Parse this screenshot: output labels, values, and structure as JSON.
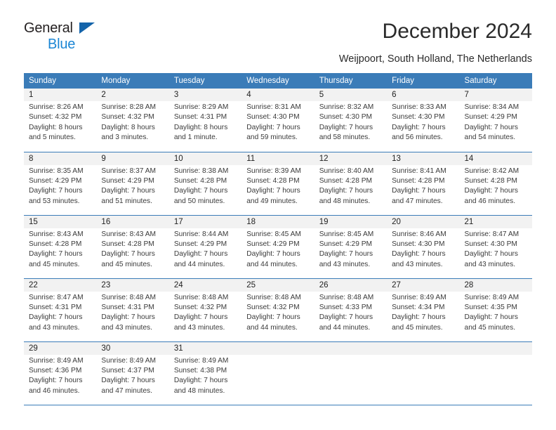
{
  "brand": {
    "name_top": "General",
    "name_bottom": "Blue",
    "accent_color": "#1b86d4",
    "triangle_color": "#1464aa"
  },
  "header": {
    "title": "December 2024",
    "subtitle": "Weijpoort, South Holland, The Netherlands"
  },
  "calendar": {
    "header_bg": "#3b7cb8",
    "weekdays": [
      "Sunday",
      "Monday",
      "Tuesday",
      "Wednesday",
      "Thursday",
      "Friday",
      "Saturday"
    ],
    "weeks": [
      [
        {
          "day": "1",
          "sunrise": "Sunrise: 8:26 AM",
          "sunset": "Sunset: 4:32 PM",
          "daylight1": "Daylight: 8 hours",
          "daylight2": "and 5 minutes."
        },
        {
          "day": "2",
          "sunrise": "Sunrise: 8:28 AM",
          "sunset": "Sunset: 4:32 PM",
          "daylight1": "Daylight: 8 hours",
          "daylight2": "and 3 minutes."
        },
        {
          "day": "3",
          "sunrise": "Sunrise: 8:29 AM",
          "sunset": "Sunset: 4:31 PM",
          "daylight1": "Daylight: 8 hours",
          "daylight2": "and 1 minute."
        },
        {
          "day": "4",
          "sunrise": "Sunrise: 8:31 AM",
          "sunset": "Sunset: 4:30 PM",
          "daylight1": "Daylight: 7 hours",
          "daylight2": "and 59 minutes."
        },
        {
          "day": "5",
          "sunrise": "Sunrise: 8:32 AM",
          "sunset": "Sunset: 4:30 PM",
          "daylight1": "Daylight: 7 hours",
          "daylight2": "and 58 minutes."
        },
        {
          "day": "6",
          "sunrise": "Sunrise: 8:33 AM",
          "sunset": "Sunset: 4:30 PM",
          "daylight1": "Daylight: 7 hours",
          "daylight2": "and 56 minutes."
        },
        {
          "day": "7",
          "sunrise": "Sunrise: 8:34 AM",
          "sunset": "Sunset: 4:29 PM",
          "daylight1": "Daylight: 7 hours",
          "daylight2": "and 54 minutes."
        }
      ],
      [
        {
          "day": "8",
          "sunrise": "Sunrise: 8:35 AM",
          "sunset": "Sunset: 4:29 PM",
          "daylight1": "Daylight: 7 hours",
          "daylight2": "and 53 minutes."
        },
        {
          "day": "9",
          "sunrise": "Sunrise: 8:37 AM",
          "sunset": "Sunset: 4:29 PM",
          "daylight1": "Daylight: 7 hours",
          "daylight2": "and 51 minutes."
        },
        {
          "day": "10",
          "sunrise": "Sunrise: 8:38 AM",
          "sunset": "Sunset: 4:28 PM",
          "daylight1": "Daylight: 7 hours",
          "daylight2": "and 50 minutes."
        },
        {
          "day": "11",
          "sunrise": "Sunrise: 8:39 AM",
          "sunset": "Sunset: 4:28 PM",
          "daylight1": "Daylight: 7 hours",
          "daylight2": "and 49 minutes."
        },
        {
          "day": "12",
          "sunrise": "Sunrise: 8:40 AM",
          "sunset": "Sunset: 4:28 PM",
          "daylight1": "Daylight: 7 hours",
          "daylight2": "and 48 minutes."
        },
        {
          "day": "13",
          "sunrise": "Sunrise: 8:41 AM",
          "sunset": "Sunset: 4:28 PM",
          "daylight1": "Daylight: 7 hours",
          "daylight2": "and 47 minutes."
        },
        {
          "day": "14",
          "sunrise": "Sunrise: 8:42 AM",
          "sunset": "Sunset: 4:28 PM",
          "daylight1": "Daylight: 7 hours",
          "daylight2": "and 46 minutes."
        }
      ],
      [
        {
          "day": "15",
          "sunrise": "Sunrise: 8:43 AM",
          "sunset": "Sunset: 4:28 PM",
          "daylight1": "Daylight: 7 hours",
          "daylight2": "and 45 minutes."
        },
        {
          "day": "16",
          "sunrise": "Sunrise: 8:43 AM",
          "sunset": "Sunset: 4:28 PM",
          "daylight1": "Daylight: 7 hours",
          "daylight2": "and 45 minutes."
        },
        {
          "day": "17",
          "sunrise": "Sunrise: 8:44 AM",
          "sunset": "Sunset: 4:29 PM",
          "daylight1": "Daylight: 7 hours",
          "daylight2": "and 44 minutes."
        },
        {
          "day": "18",
          "sunrise": "Sunrise: 8:45 AM",
          "sunset": "Sunset: 4:29 PM",
          "daylight1": "Daylight: 7 hours",
          "daylight2": "and 44 minutes."
        },
        {
          "day": "19",
          "sunrise": "Sunrise: 8:45 AM",
          "sunset": "Sunset: 4:29 PM",
          "daylight1": "Daylight: 7 hours",
          "daylight2": "and 43 minutes."
        },
        {
          "day": "20",
          "sunrise": "Sunrise: 8:46 AM",
          "sunset": "Sunset: 4:30 PM",
          "daylight1": "Daylight: 7 hours",
          "daylight2": "and 43 minutes."
        },
        {
          "day": "21",
          "sunrise": "Sunrise: 8:47 AM",
          "sunset": "Sunset: 4:30 PM",
          "daylight1": "Daylight: 7 hours",
          "daylight2": "and 43 minutes."
        }
      ],
      [
        {
          "day": "22",
          "sunrise": "Sunrise: 8:47 AM",
          "sunset": "Sunset: 4:31 PM",
          "daylight1": "Daylight: 7 hours",
          "daylight2": "and 43 minutes."
        },
        {
          "day": "23",
          "sunrise": "Sunrise: 8:48 AM",
          "sunset": "Sunset: 4:31 PM",
          "daylight1": "Daylight: 7 hours",
          "daylight2": "and 43 minutes."
        },
        {
          "day": "24",
          "sunrise": "Sunrise: 8:48 AM",
          "sunset": "Sunset: 4:32 PM",
          "daylight1": "Daylight: 7 hours",
          "daylight2": "and 43 minutes."
        },
        {
          "day": "25",
          "sunrise": "Sunrise: 8:48 AM",
          "sunset": "Sunset: 4:32 PM",
          "daylight1": "Daylight: 7 hours",
          "daylight2": "and 44 minutes."
        },
        {
          "day": "26",
          "sunrise": "Sunrise: 8:48 AM",
          "sunset": "Sunset: 4:33 PM",
          "daylight1": "Daylight: 7 hours",
          "daylight2": "and 44 minutes."
        },
        {
          "day": "27",
          "sunrise": "Sunrise: 8:49 AM",
          "sunset": "Sunset: 4:34 PM",
          "daylight1": "Daylight: 7 hours",
          "daylight2": "and 45 minutes."
        },
        {
          "day": "28",
          "sunrise": "Sunrise: 8:49 AM",
          "sunset": "Sunset: 4:35 PM",
          "daylight1": "Daylight: 7 hours",
          "daylight2": "and 45 minutes."
        }
      ],
      [
        {
          "day": "29",
          "sunrise": "Sunrise: 8:49 AM",
          "sunset": "Sunset: 4:36 PM",
          "daylight1": "Daylight: 7 hours",
          "daylight2": "and 46 minutes."
        },
        {
          "day": "30",
          "sunrise": "Sunrise: 8:49 AM",
          "sunset": "Sunset: 4:37 PM",
          "daylight1": "Daylight: 7 hours",
          "daylight2": "and 47 minutes."
        },
        {
          "day": "31",
          "sunrise": "Sunrise: 8:49 AM",
          "sunset": "Sunset: 4:38 PM",
          "daylight1": "Daylight: 7 hours",
          "daylight2": "and 48 minutes."
        },
        {
          "day": "",
          "sunrise": "",
          "sunset": "",
          "daylight1": "",
          "daylight2": ""
        },
        {
          "day": "",
          "sunrise": "",
          "sunset": "",
          "daylight1": "",
          "daylight2": ""
        },
        {
          "day": "",
          "sunrise": "",
          "sunset": "",
          "daylight1": "",
          "daylight2": ""
        },
        {
          "day": "",
          "sunrise": "",
          "sunset": "",
          "daylight1": "",
          "daylight2": ""
        }
      ]
    ]
  }
}
